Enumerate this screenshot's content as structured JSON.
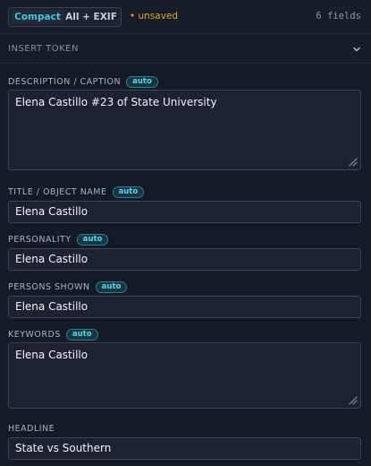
{
  "toolbar": {
    "modes": [
      "Compact",
      "All + EXIF"
    ],
    "active_mode": "Compact",
    "status": "• unsaved",
    "field_count": "6 fields"
  },
  "insert_token": {
    "label": "INSERT TOKEN",
    "icon": "chevron-down-icon"
  },
  "fields": [
    {
      "label": "DESCRIPTION / CAPTION",
      "badge": "auto",
      "value": "Elena Castillo #23 of State University"
    },
    {
      "label": "TITLE / OBJECT NAME",
      "badge": "auto",
      "value": "Elena Castillo"
    },
    {
      "label": "PERSONALITY",
      "badge": "auto",
      "value": "Elena Castillo"
    },
    {
      "label": "PERSONS SHOWN",
      "badge": "auto",
      "value": "Elena Castillo"
    },
    {
      "label": "KEYWORDS",
      "badge": "auto",
      "value": "Elena Castillo"
    },
    {
      "label": "HEADLINE",
      "value": "State vs Southern"
    }
  ],
  "colors": {
    "background": "#151b26",
    "accent": "#46c6de",
    "unsaved": "#e0a526"
  }
}
